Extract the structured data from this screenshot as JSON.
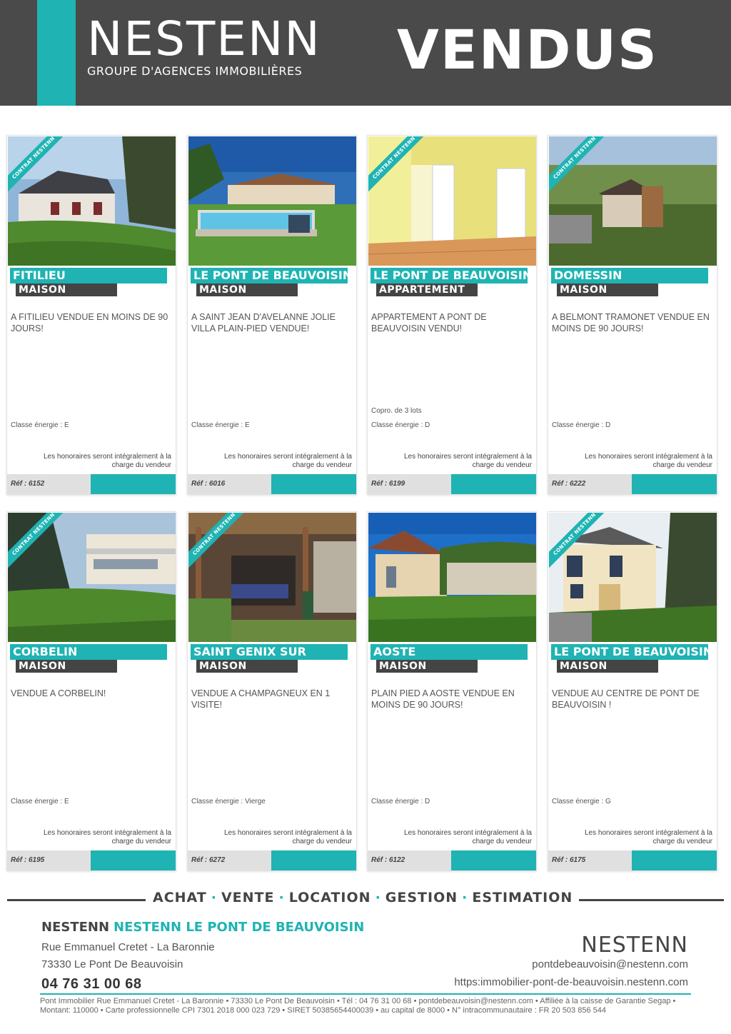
{
  "header": {
    "brand_name": "NESTENN",
    "brand_subtitle": "GROUPE D'AGENCES IMMOBILIÈRES",
    "title": "VENDUS",
    "colors": {
      "dark": "#4a4a4a",
      "accent": "#1fb3b3"
    }
  },
  "listings": [
    {
      "ribbon": "CONTRAT NESTENN",
      "city": "FITILIEU",
      "type": "MAISON",
      "description": "A FITILIEU VENDUE EN MOINS DE 90 JOURS!",
      "copro": "",
      "energy": "Classe énergie : E",
      "fees": "Les honoraires seront intégralement à la charge du vendeur",
      "ref": "Réf : 6152",
      "has_ribbon": true
    },
    {
      "ribbon": "",
      "city": "LE PONT DE BEAUVOISIN",
      "type": "MAISON",
      "description": "A SAINT JEAN D'AVELANNE JOLIE VILLA PLAIN-PIED VENDUE!",
      "copro": "",
      "energy": "Classe énergie : E",
      "fees": "Les honoraires seront intégralement à la charge du vendeur",
      "ref": "Réf : 6016",
      "has_ribbon": false
    },
    {
      "ribbon": "CONTRAT NESTENN",
      "city": "LE PONT DE BEAUVOISIN",
      "type": "APPARTEMENT",
      "description": "APPARTEMENT A PONT DE BEAUVOISIN VENDU!",
      "copro": "Copro. de 3 lots",
      "energy": "Classe énergie : D",
      "fees": "Les honoraires seront intégralement à la charge du vendeur",
      "ref": "Réf : 6199",
      "has_ribbon": true
    },
    {
      "ribbon": "CONTRAT NESTENN",
      "city": "DOMESSIN",
      "type": "MAISON",
      "description": "A BELMONT TRAMONET VENDUE EN MOINS DE 90 JOURS!",
      "copro": "",
      "energy": "Classe énergie : D",
      "fees": "Les honoraires seront intégralement à la charge du vendeur",
      "ref": "Réf : 6222",
      "has_ribbon": true
    },
    {
      "ribbon": "CONTRAT NESTENN",
      "city": "CORBELIN",
      "type": "MAISON",
      "description": "VENDUE A CORBELIN!",
      "copro": "",
      "energy": "Classe énergie : E",
      "fees": "Les honoraires seront intégralement à la charge du vendeur",
      "ref": "Réf : 6195",
      "has_ribbon": true
    },
    {
      "ribbon": "CONTRAT NESTENN",
      "city": "SAINT GENIX SUR",
      "type": "MAISON",
      "description": "VENDUE A CHAMPAGNEUX EN 1 VISITE!",
      "copro": "",
      "energy": "Classe énergie : Vierge",
      "fees": "Les honoraires seront intégralement à la charge du vendeur",
      "ref": "Réf : 6272",
      "has_ribbon": true
    },
    {
      "ribbon": "",
      "city": "AOSTE",
      "type": "MAISON",
      "description": "PLAIN PIED A AOSTE VENDUE EN MOINS DE 90 JOURS!",
      "copro": "",
      "energy": "Classe énergie : D",
      "fees": "Les honoraires seront intégralement à la charge du vendeur",
      "ref": "Réf : 6122",
      "has_ribbon": false
    },
    {
      "ribbon": "CONTRAT NESTENN",
      "city": "LE PONT DE BEAUVOISIN",
      "type": "MAISON",
      "description": "VENDUE AU CENTRE DE PONT DE BEAUVOISIN !",
      "copro": "",
      "energy": "Classe énergie : G",
      "fees": "Les honoraires seront intégralement à la charge du vendeur",
      "ref": "Réf : 6175",
      "has_ribbon": true
    }
  ],
  "services": [
    "ACHAT",
    "VENTE",
    "LOCATION",
    "GESTION",
    "ESTIMATION"
  ],
  "footer": {
    "agency_prefix": "NESTENN",
    "agency_name": "NESTENN LE PONT DE BEAUVOISIN",
    "address_line1": "Rue Emmanuel Cretet - La Baronnie",
    "address_line2": "73330 Le Pont De Beauvoisin",
    "phone": "04 76 31 00 68",
    "logo": "NESTENN",
    "email": "pontdebeauvoisin@nestenn.com",
    "website": "https:immobilier-pont-de-beauvoisin.nestenn.com",
    "legal": "Pont Immobilier Rue Emmanuel Cretet - La Baronnie • 73330 Le Pont De Beauvoisin • Tél : 04 76 31 00 68 • pontdebeauvoisin@nestenn.com • Affiliée à la caisse de Garantie Segap • Montant: 110000 • Carte professionnelle CPI 7301 2018 000 023 729 • SIRET 50385654400039 • au capital de 8000 • N° intracommunautaire : FR 20 503 856 544"
  }
}
